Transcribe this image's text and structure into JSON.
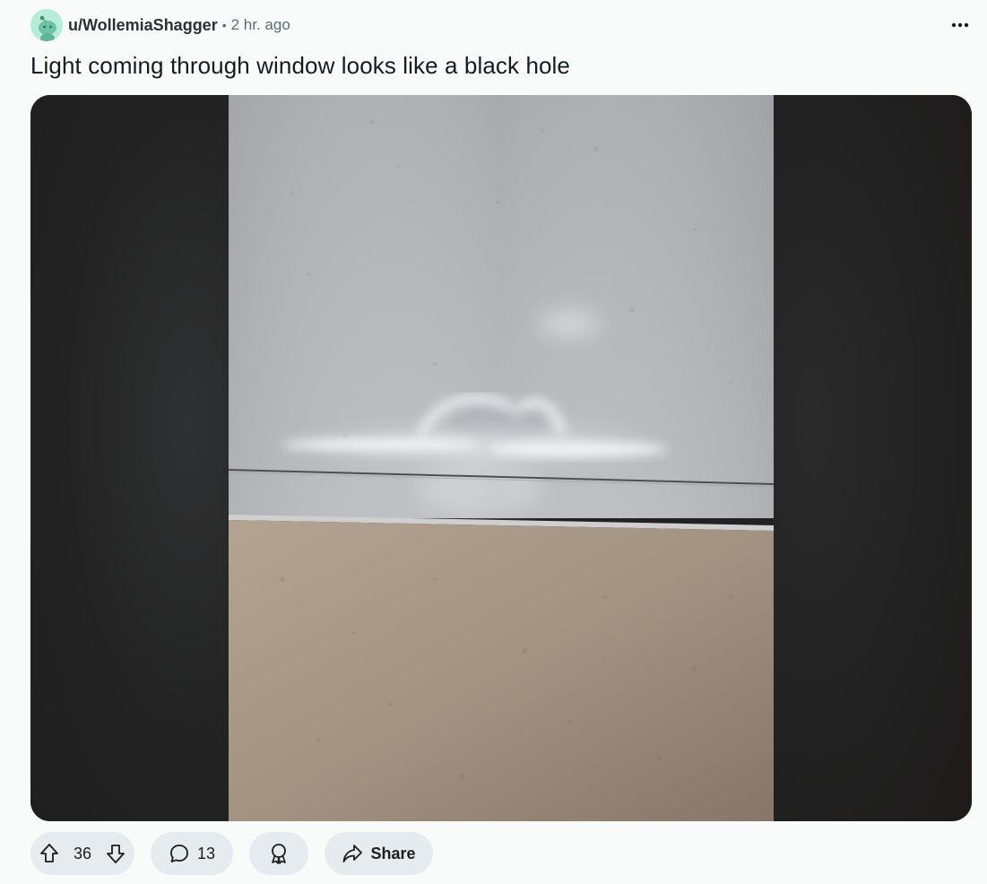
{
  "post": {
    "author": "u/WollemiaShagger",
    "separator": "•",
    "time": "2 hr. ago",
    "title": "Light coming through window looks like a black hole"
  },
  "actions": {
    "votes": "36",
    "comments": "13",
    "share_label": "Share"
  },
  "icons": {
    "avatar": "snoo-avatar-icon",
    "more": "more-options-icon",
    "upvote": "upvote-arrow-icon",
    "downvote": "downvote-arrow-icon",
    "comment": "comment-bubble-icon",
    "award": "award-ribbon-icon",
    "share": "share-arrow-icon"
  },
  "colors": {
    "page_bg": "#f9fafa",
    "pill_bg": "#e5ebee",
    "avatar_bg": "#b7ecd9",
    "meta_text": "#576f76"
  }
}
